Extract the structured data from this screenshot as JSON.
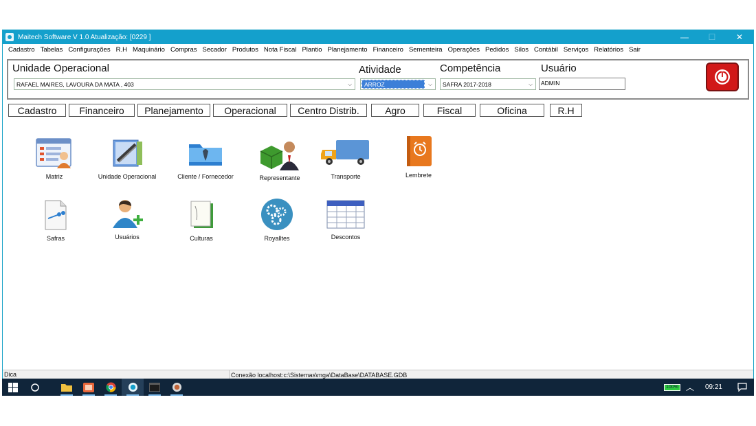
{
  "window": {
    "title": "Maitech Software   V 1.0   Atualização:  [0229 ]",
    "controls": [
      "—",
      "☐",
      "✕"
    ]
  },
  "menu": [
    "Cadastro",
    "Tabelas",
    "Configurações",
    "R.H",
    "Maquinário",
    "Compras",
    "Secador",
    "Produtos",
    "Nota Fiscal",
    "Plantio",
    "Planejamento",
    "Financeiro",
    "Sementeira",
    "Operações",
    "Pedidos",
    "Silos",
    "Contábil",
    "Serviços",
    "Relatórios",
    "Sair"
  ],
  "form": {
    "unidade_label": "Unidade Operacional",
    "unidade_value": "RAFAEL MAIRES, LAVOURA DA MATA , 403",
    "atividade_label": "Atividade",
    "atividade_value": "ARROZ",
    "competencia_label": "Competência",
    "competencia_value": "SAFRA 2017-2018",
    "usuario_label": "Usuário",
    "usuario_value": "ADMIN"
  },
  "tabs": [
    "Cadastro",
    "Financeiro",
    "Planejamento",
    "Operacional",
    "Centro Distrib.",
    "Agro",
    "Fiscal",
    "Oficina",
    "R.H"
  ],
  "icons": {
    "row1": [
      "Matriz",
      "Unidade Operacional",
      "Cliente / Fornecedor",
      "Representante",
      "Transporte",
      "Lembrete"
    ],
    "row2": [
      "Safras",
      "Usuários",
      "Culturas",
      "Royalltes",
      "Descontos"
    ]
  },
  "status": {
    "dica": "Dica",
    "conexao": "Conexão  localhost:c:\\Sistemas\\mga\\DataBase\\DATABASE.GDB"
  },
  "taskbar": {
    "battery": "100%",
    "time": "09:21"
  },
  "colors": {
    "titlebar": "#14a0cc",
    "power_button": "#d11818",
    "selected_combo": "#3c7fd8",
    "taskbar": "#10253a"
  }
}
